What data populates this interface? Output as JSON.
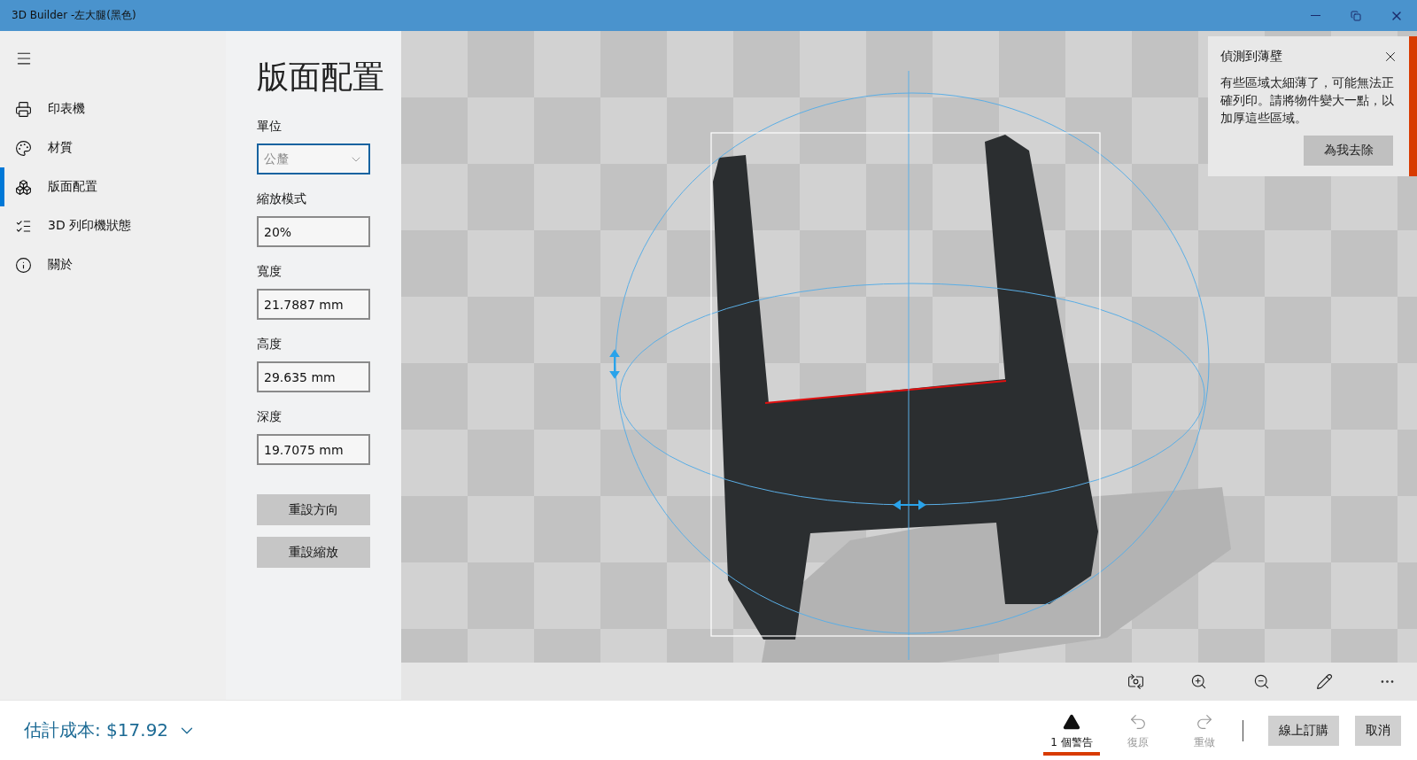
{
  "window": {
    "title": "3D Builder -左大腿(黑色)"
  },
  "sidebar": {
    "items": [
      {
        "label": "印表機",
        "selected": false
      },
      {
        "label": "材質",
        "selected": false
      },
      {
        "label": "版面配置",
        "selected": true
      },
      {
        "label": "3D 列印機狀態",
        "selected": false
      },
      {
        "label": "關於",
        "selected": false
      }
    ]
  },
  "panel": {
    "title": "版面配置",
    "fields": [
      {
        "label": "單位",
        "kind": "dropdown",
        "value": "公釐"
      },
      {
        "label": "縮放模式",
        "kind": "text",
        "value": "20%"
      },
      {
        "label": "寬度",
        "kind": "text",
        "value": "21.7887 mm"
      },
      {
        "label": "高度",
        "kind": "text",
        "value": "29.635 mm"
      },
      {
        "label": "深度",
        "kind": "text",
        "value": "19.7075 mm"
      }
    ],
    "buttons": [
      "重設方向",
      "重設縮放"
    ]
  },
  "notification": {
    "title": "偵測到薄壁",
    "message": "有些區域太細薄了，可能無法正確列印。請將物件變大一點，以加厚這些區域。",
    "button": "為我去除"
  },
  "cost": "估計成本: $17.92",
  "actions": [
    {
      "label": "1 個警告",
      "selected": true,
      "disabled": false
    },
    {
      "label": "復原",
      "selected": false,
      "disabled": true
    },
    {
      "label": "重做",
      "selected": false,
      "disabled": true
    }
  ],
  "buttons": [
    "線上訂購",
    "取消"
  ]
}
